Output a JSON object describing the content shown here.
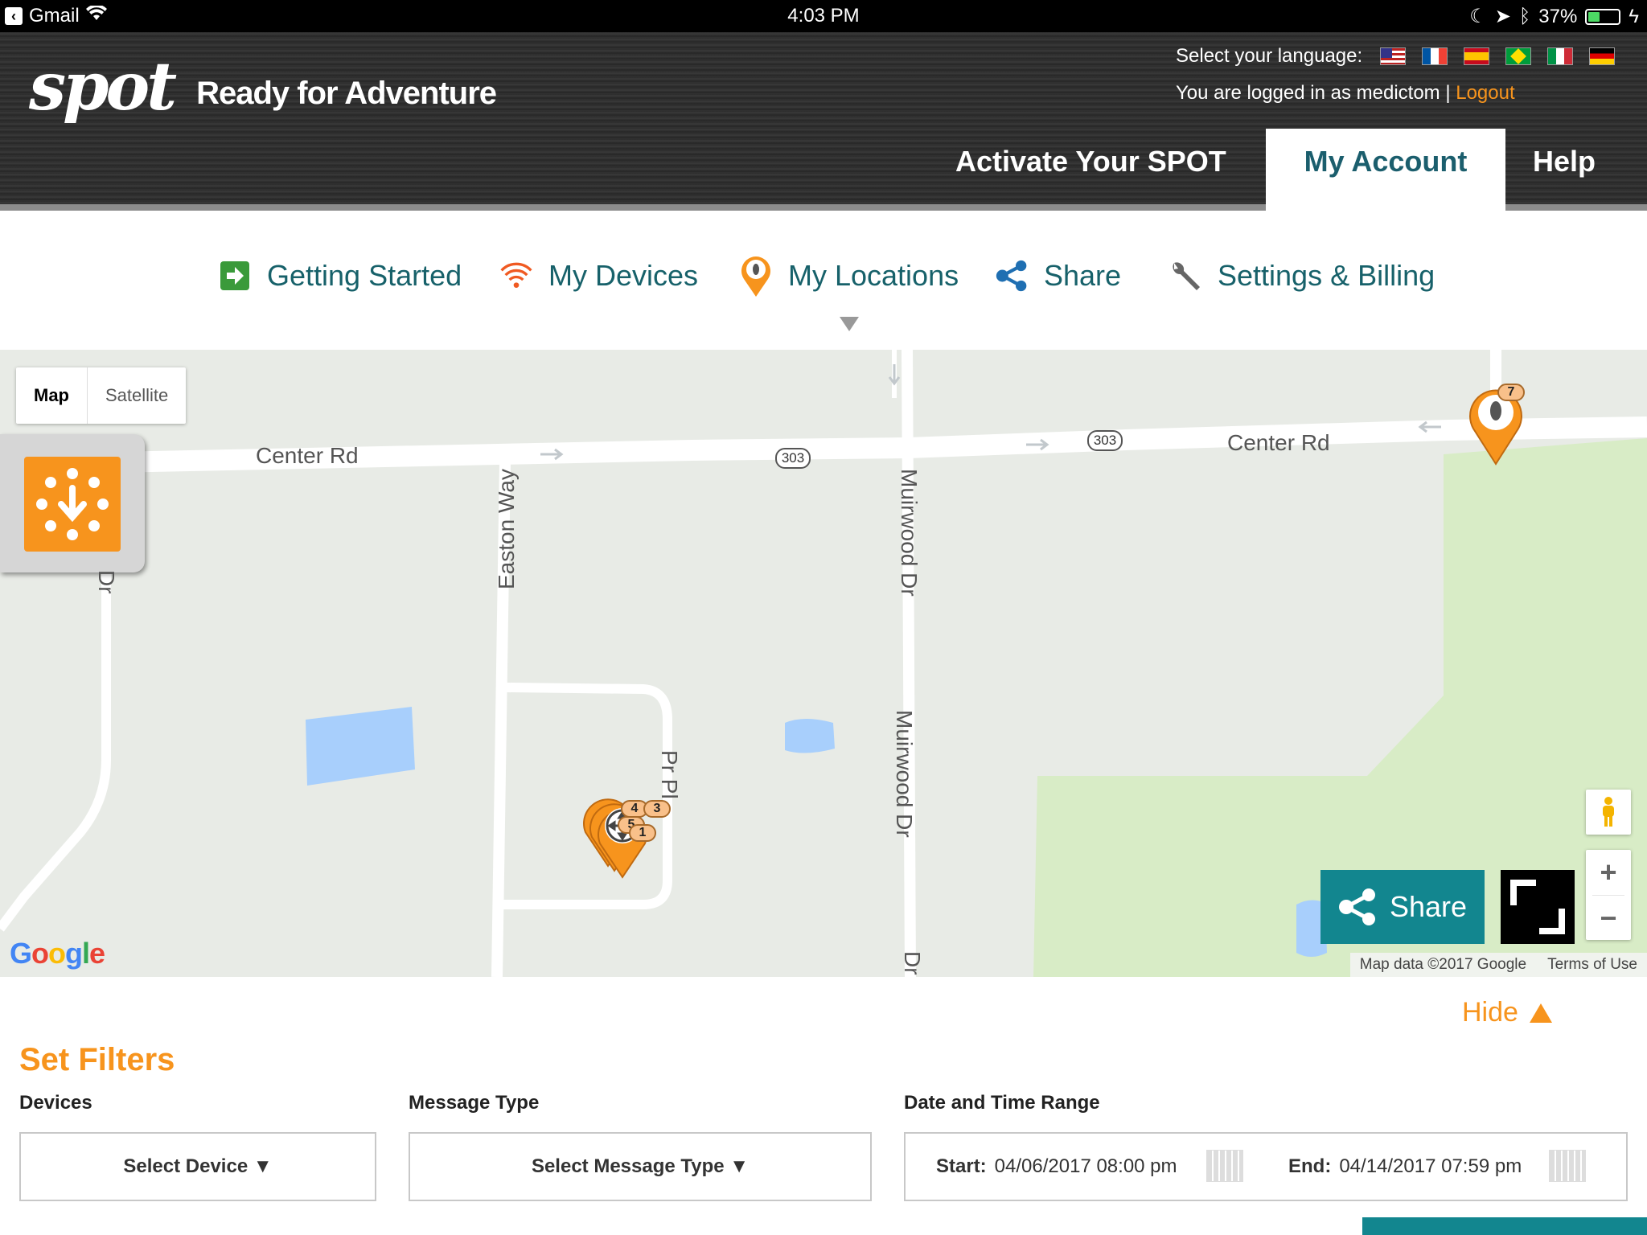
{
  "statusbar": {
    "back_app": "Gmail",
    "time": "4:03 PM",
    "battery": "37%",
    "battery_level": 0.37
  },
  "header": {
    "logo_text": "spot",
    "tagline": "Ready for Adventure",
    "language_label": "Select your language:",
    "languages": [
      "English",
      "French",
      "Spanish",
      "Portuguese",
      "Italian",
      "German"
    ],
    "logged_in_text": "You are logged in as medictom |",
    "logout_label": "Logout",
    "nav": {
      "activate": "Activate Your SPOT",
      "account": "My Account",
      "help": "Help"
    }
  },
  "subnav": {
    "getting_started": "Getting Started",
    "my_devices": "My Devices",
    "my_locations": "My Locations",
    "share": "Share",
    "settings_billing": "Settings & Billing"
  },
  "map": {
    "type_map": "Map",
    "type_satellite": "Satellite",
    "roads": {
      "center_rd_1": "Center Rd",
      "center_rd_2": "Center Rd",
      "easton_way": "Easton Way",
      "muirwood_1": "Muirwood Dr",
      "muirwood_2": "Muirwood Dr",
      "partial_dr": "Dr",
      "partial_dr_bottom": "Dr",
      "partial_pl": "Pr      Pl",
      "route_1": "303",
      "route_2": "303"
    },
    "markers": {
      "badge_7": "7",
      "badge_4": "4",
      "badge_3": "3",
      "badge_5": "5",
      "badge_1": "1"
    },
    "share_label": "Share",
    "zoom_in": "+",
    "zoom_out": "−",
    "google": [
      "G",
      "o",
      "o",
      "g",
      "l",
      "e"
    ],
    "map_data": "Map data ©2017 Google",
    "terms": "Terms of Use",
    "colors": {
      "land": "#e8ebe6",
      "park": "#d8ecc6",
      "water": "#a8cffc",
      "road": "#ffffff",
      "pin": "#f7941d"
    }
  },
  "filters": {
    "hide_label": "Hide",
    "title": "Set Filters",
    "devices_label": "Devices",
    "devices_value": "Select Device ▼",
    "message_type_label": "Message Type",
    "message_type_value": "Select Message Type ▼",
    "date_range_label": "Date and Time Range",
    "start_label": "Start:",
    "start_value": "04/06/2017 08:00 pm",
    "end_label": "End:",
    "end_value": "04/14/2017 07:59 pm"
  },
  "accent_colors": {
    "orange": "#f7941d",
    "teal": "#12868f",
    "nav_text": "#17616a"
  }
}
